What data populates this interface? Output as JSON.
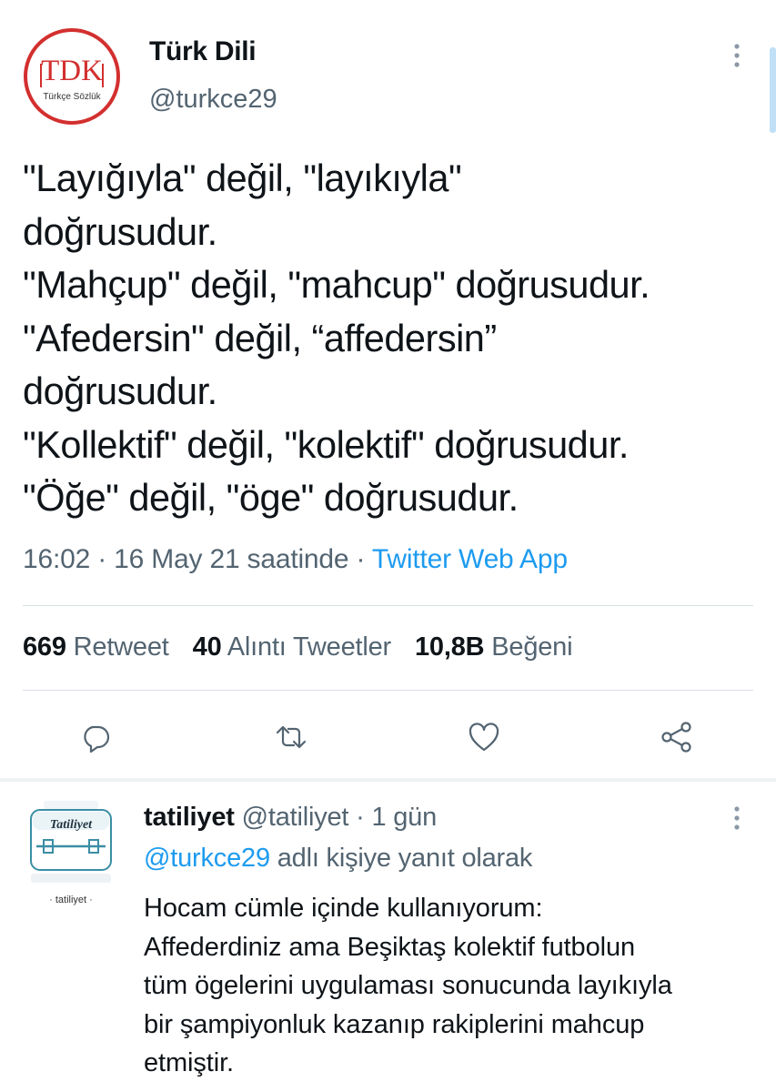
{
  "tweet": {
    "author": {
      "name": "Türk Dili",
      "handle": "@turkce29",
      "avatar_text": "TDK",
      "avatar_subtext": "Türkçe Sözlük",
      "avatar_color": "#d32f2f"
    },
    "body_lines": [
      "\"Layığıyla\" değil, \"layıkıyla\"",
      "doğrusudur.",
      "\"Mahçup\" değil, \"mahcup\" doğrusudur.",
      "\"Afedersin\" değil, “affedersin”",
      "doğrusudur.",
      "\"Kollektif\" değil, \"kolektif\" doğrusudur.",
      "\"Öğe\" değil, \"öge\" doğrusudur."
    ],
    "time": "16:02",
    "date": "16 May 21 saatinde",
    "separator": " · ",
    "source": "Twitter Web App",
    "stats": {
      "retweets": {
        "count": "669",
        "label": "Retweet"
      },
      "quotes": {
        "count": "40",
        "label": "Alıntı Tweetler"
      },
      "likes": {
        "count": "10,8B",
        "label": "Beğeni"
      }
    },
    "actions": [
      "reply-icon",
      "retweet-icon",
      "like-icon",
      "share-icon"
    ]
  },
  "reply": {
    "name": "tatiliyet",
    "handle": "@tatiliyet",
    "separator": " · ",
    "age": "1 gün",
    "replying_mention": "@turkce29",
    "replying_suffix": " adlı kişiye yanıt olarak",
    "avatar_text": "Tatiliyet",
    "avatar_caption": "· tatiliyet ·",
    "body_lines": [
      "Hocam cümle içinde kullanıyorum:",
      "Affederdiniz ama Beşiktaş kolektif futbolun",
      "tüm ögelerini uygulaması sonucunda layıkıyla",
      "bir şampiyonluk kazanıp rakiplerini mahcup",
      "etmiştir."
    ]
  },
  "colors": {
    "accent": "#1d9bf0",
    "secondary_text": "#536471",
    "primary_text": "#0f1419"
  }
}
